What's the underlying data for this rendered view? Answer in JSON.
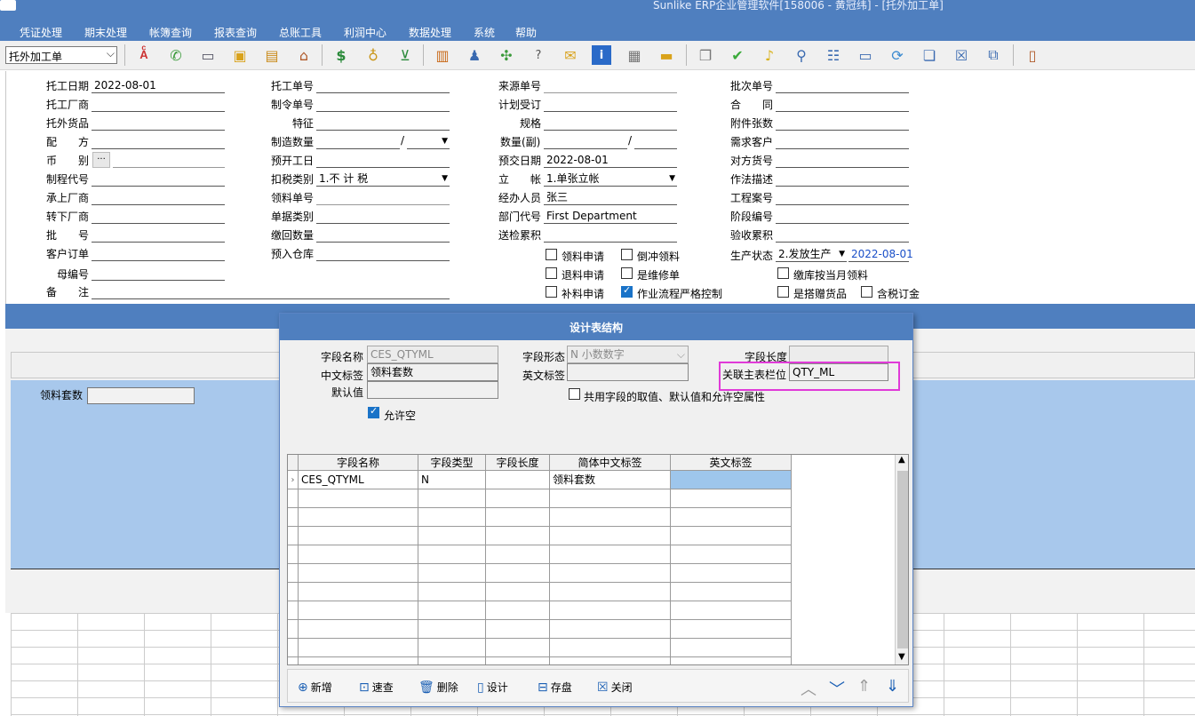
{
  "window": {
    "title": "Sunlike ERP企业管理软件[158006 - 黄冠纬] - [托外加工单]"
  },
  "menu": [
    "凭证处理",
    "期末处理",
    "帐簿查询",
    "报表查询",
    "总账工具",
    "利润中心",
    "数据处理",
    "系统",
    "帮助"
  ],
  "toolbar": {
    "doc_select": "托外加工单",
    "icons": [
      "spell-icon",
      "phone-icon",
      "computer-icon",
      "lock-icon",
      "briefcase-icon",
      "home-icon",
      "dollar-icon",
      "moneybag-icon",
      "cart-icon",
      "clipboard-icon",
      "users-icon",
      "satellite-icon",
      "help-icon",
      "mail-icon",
      "info-icon",
      "calculator-icon",
      "folder-icon",
      "copy-icon",
      "check-icon",
      "bell-icon",
      "search-icon",
      "org-icon",
      "monitor-icon",
      "refresh-icon",
      "window-icon",
      "close-icon",
      "restore-icon",
      "exit-icon"
    ]
  },
  "form": {
    "col1": [
      {
        "label": "托工日期",
        "value": "2022-08-01"
      },
      {
        "label": "托工厂商",
        "value": ""
      },
      {
        "label": "托外货品",
        "value": ""
      },
      {
        "label": "配　　方",
        "value": ""
      },
      {
        "label": "币　　别",
        "value": ""
      },
      {
        "label": "制程代号",
        "value": ""
      },
      {
        "label": "承上厂商",
        "value": ""
      },
      {
        "label": "转下厂商",
        "value": ""
      },
      {
        "label": "批　　号",
        "value": ""
      },
      {
        "label": "客户订单",
        "value": ""
      },
      {
        "label": "母编号",
        "value": ""
      },
      {
        "label": "备　　注",
        "value": ""
      }
    ],
    "col2": [
      {
        "label": "托工单号",
        "value": ""
      },
      {
        "label": "制令单号",
        "value": ""
      },
      {
        "label": "特征",
        "value": ""
      },
      {
        "label": "制造数量",
        "value": ""
      },
      {
        "label": "预开工日",
        "value": ""
      },
      {
        "label": "扣税类别",
        "value": "1.不 计 税"
      },
      {
        "label": "领料单号",
        "value": ""
      },
      {
        "label": "单据类别",
        "value": ""
      },
      {
        "label": "缴回数量",
        "value": ""
      },
      {
        "label": "预入仓库",
        "value": ""
      }
    ],
    "col3": [
      {
        "label": "来源单号",
        "value": ""
      },
      {
        "label": "计划受订",
        "value": ""
      },
      {
        "label": "规格",
        "value": ""
      },
      {
        "label": "数量(副)",
        "value": ""
      },
      {
        "label": "预交日期",
        "value": "2022-08-01"
      },
      {
        "label": "立　　帐",
        "value": "1.单张立帐"
      },
      {
        "label": "经办人员",
        "value": "张三"
      },
      {
        "label": "部门代号",
        "value": "First Department"
      },
      {
        "label": "送检累积",
        "value": ""
      }
    ],
    "col4": [
      {
        "label": "批次单号",
        "value": ""
      },
      {
        "label": "合　　同",
        "value": ""
      },
      {
        "label": "附件张数",
        "value": ""
      },
      {
        "label": "需求客户",
        "value": ""
      },
      {
        "label": "对方货号",
        "value": ""
      },
      {
        "label": "作法描述",
        "value": ""
      },
      {
        "label": "工程案号",
        "value": ""
      },
      {
        "label": "阶段编号",
        "value": ""
      },
      {
        "label": "验收累积",
        "value": ""
      },
      {
        "label": "生产状态",
        "value": "2.发放生产"
      }
    ],
    "status_date": "2022-08-01",
    "slash": "/",
    "ellipsis": "···",
    "checkboxes": [
      {
        "label": "领料申请",
        "checked": false
      },
      {
        "label": "倒冲领料",
        "checked": false
      },
      {
        "label": "退料申请",
        "checked": false
      },
      {
        "label": "是维修单",
        "checked": false
      },
      {
        "label": "补料申请",
        "checked": false
      },
      {
        "label": "作业流程严格控制",
        "checked": true
      },
      {
        "label": "缴库按当月领料",
        "checked": false
      },
      {
        "label": "是搭赠货品",
        "checked": false
      },
      {
        "label": "含税订金",
        "checked": false
      }
    ]
  },
  "lower": {
    "field_label": "领料套数"
  },
  "dialog": {
    "title": "设计表结构",
    "field_name_label": "字段名称",
    "field_name_value": "CES_QTYML",
    "field_type_label": "字段形态",
    "field_type_value": "N 小数数字",
    "field_len_label": "字段长度",
    "cn_label_label": "中文标签",
    "cn_label_value": "领料套数",
    "en_label_label": "英文标签",
    "en_label_value": "",
    "link_label": "关联主表栏位",
    "link_value": "QTY_ML",
    "default_label": "默认值",
    "shared_label": "共用字段的取值、默认值和允许空属性",
    "allow_null_label": "允许空",
    "allow_null_checked": true,
    "table": {
      "columns": [
        "字段名称",
        "字段类型",
        "字段长度",
        "简体中文标签",
        "英文标签"
      ],
      "rows": [
        [
          "CES_QTYML",
          "N",
          "",
          "领料套数",
          ""
        ]
      ]
    },
    "buttons": {
      "add": "新增",
      "quick": "速查",
      "delete": "删除",
      "design": "设计",
      "save": "存盘",
      "close": "关闭"
    }
  }
}
